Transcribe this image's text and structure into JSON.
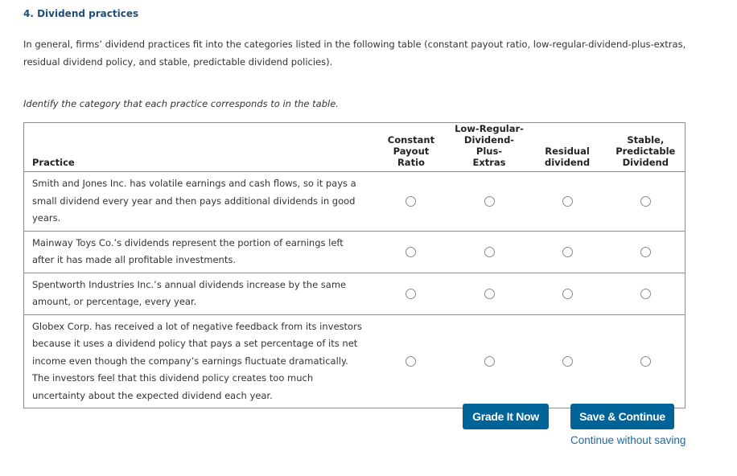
{
  "question": {
    "title": "4. Dividend practices",
    "intro": "In general, firms’ dividend practices fit into the categories listed in the following table (constant payout ratio, low-regular-dividend-plus-extras, residual dividend policy, and stable, predictable dividend policies).",
    "instruction": "Identify the category that each practice corresponds to in the table."
  },
  "table": {
    "practice_header": "Practice",
    "columns": [
      {
        "lines": [
          "Constant",
          "Payout",
          "Ratio"
        ]
      },
      {
        "lines": [
          "Low-Regular-",
          "Dividend-Plus-",
          "Extras"
        ]
      },
      {
        "lines": [
          "",
          "Residual",
          "dividend"
        ]
      },
      {
        "lines": [
          "Stable,",
          "Predictable",
          "Dividend"
        ]
      }
    ],
    "rows": [
      {
        "text": "Smith and Jones Inc. has volatile earnings and cash flows, so it pays a small dividend every year and then pays additional dividends in good years.",
        "selected": null
      },
      {
        "text": "Mainway Toys Co.’s dividends represent the portion of earnings left after it has made all profitable investments.",
        "selected": null
      },
      {
        "text": "Spentworth Industries Inc.’s annual dividends increase by the same amount, or percentage, every year.",
        "selected": null
      },
      {
        "text": "Globex Corp. has received a lot of negative feedback from its investors because it uses a dividend policy that pays a set percentage of its net income even though the company’s earnings fluctuate dramatically. The investors feel that this dividend policy creates too much uncertainty about the expected dividend each year.",
        "selected": null
      }
    ]
  },
  "actions": {
    "grade_label": "Grade It Now",
    "save_label": "Save & Continue",
    "continue_link": "Continue without saving"
  },
  "colors": {
    "title": "#1f4e79",
    "button": "#006499",
    "link": "#1c6aa0"
  }
}
